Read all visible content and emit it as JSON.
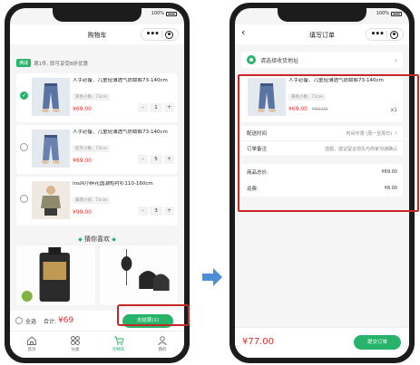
{
  "status_bar": {
    "battery_pct": "100%"
  },
  "cart_screen": {
    "title": "购物车",
    "promo": {
      "badge": "满减",
      "text": "满1件, 即可享受8折优惠"
    },
    "items": [
      {
        "title": "人手必备、儿童轻薄透气防蚊裤73-140cm",
        "spec": "黄色小象、73cm",
        "price": "¥69.00",
        "qty": "1",
        "checked": true
      },
      {
        "title": "人手必备、儿童轻薄透气防蚊裤73-140cm",
        "spec": "鸵鸟小象、73cm",
        "price": "¥69.00",
        "qty": "5",
        "checked": false
      },
      {
        "title": "ins风小碎花国潮短衬衫110-160cm",
        "spec": "藕荷小孩、73cm",
        "price": "¥99.00",
        "qty": "3",
        "checked": false
      }
    ],
    "guess_title": "猜你喜欢",
    "checkout": {
      "select_all": "全选",
      "total_label": "合计:",
      "total": "¥69",
      "button": "去结算(1)"
    },
    "tabs": [
      {
        "label": "首页",
        "icon": "home-icon"
      },
      {
        "label": "分类",
        "icon": "grid-icon"
      },
      {
        "label": "购物车",
        "icon": "cart-icon"
      },
      {
        "label": "我的",
        "icon": "user-icon"
      }
    ]
  },
  "order_screen": {
    "title": "填写订单",
    "address_placeholder": "请选择收货地址",
    "item": {
      "title": "人手必备、儿童轻薄透气防蚊裤73-140cm",
      "spec": "黄色小象、73cm",
      "price": "¥69.00",
      "old_price": "¥69.00",
      "qty": "x1"
    },
    "delivery": {
      "label": "配送时间",
      "value": "时间不限 (周一至周日)"
    },
    "remark": {
      "label": "订单备注",
      "value": "选题，建议留言前先与商家沟通确认"
    },
    "goods_total": {
      "label": "商品总价:",
      "value": "¥69.00"
    },
    "shipping": {
      "label": "运费:",
      "value": "¥8.00"
    },
    "pay_total": "¥77.00",
    "submit": "提交订单"
  },
  "colors": {
    "accent": "#27b36a",
    "price": "#e03030",
    "highlight": "#c62828",
    "arrow": "#4d8fd6"
  }
}
